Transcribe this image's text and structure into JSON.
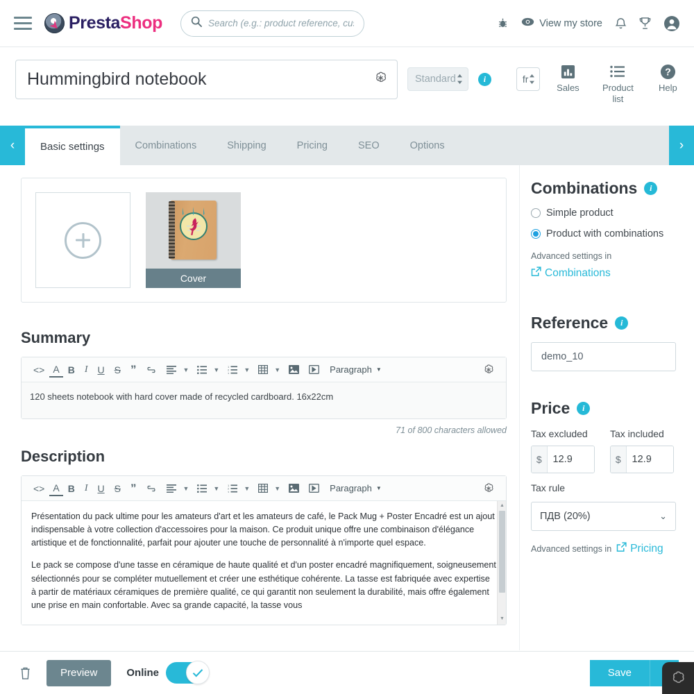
{
  "topnav": {
    "menu_icon": "hamburger-icon",
    "brand": {
      "pre": "Presta",
      "post": "Shop"
    },
    "search": {
      "placeholder": "Search (e.g.: product reference, custon",
      "value": "",
      "icon": "search-icon"
    },
    "bug_icon": "bug-icon",
    "view_store": {
      "label": "View my store",
      "icon": "eye-icon"
    },
    "bell_icon": "bell-icon",
    "trophy_icon": "trophy-icon",
    "account_icon": "user-avatar-icon"
  },
  "product_header": {
    "name_value": "Hummingbird notebook",
    "name_ai_icon": "ai-assistant-icon",
    "type_select": "Standard",
    "type_info_icon": "info-icon",
    "language_select": "fr",
    "actions": [
      {
        "label": "Sales",
        "icon": "bar-chart-icon"
      },
      {
        "label": "Product list",
        "icon": "list-icon"
      },
      {
        "label": "Help",
        "icon": "question-mark-icon"
      }
    ]
  },
  "tabs": {
    "prev_label": "‹",
    "next_label": "›",
    "items": [
      {
        "label": "Basic settings",
        "active": true
      },
      {
        "label": "Combinations",
        "active": false
      },
      {
        "label": "Shipping",
        "active": false
      },
      {
        "label": "Pricing",
        "active": false
      },
      {
        "label": "SEO",
        "active": false
      },
      {
        "label": "Options",
        "active": false
      }
    ]
  },
  "images": {
    "add_tile_icon": "plus-circle-icon",
    "cover_label": "Cover"
  },
  "summary": {
    "title": "Summary",
    "toolbar": {
      "source": "<>",
      "text_color": "A",
      "bold": "B",
      "italic": "I",
      "underline": "U",
      "strikethrough": "S",
      "quote": "”",
      "link": "link-icon",
      "align": "align-left-icon",
      "bullet_list": "bullet-list-icon",
      "number_list": "numbered-list-icon",
      "table": "table-icon",
      "image": "image-icon",
      "video": "video-icon",
      "paragraph": "Paragraph",
      "ai": "ai-assistant-icon"
    },
    "content": "120 sheets notebook with hard cover made of recycled cardboard. 16x22cm",
    "char_count": "71 of 800 characters allowed"
  },
  "description": {
    "title": "Description",
    "paragraphs": [
      "Présentation du pack ultime pour les amateurs d'art et les amateurs de café, le Pack Mug + Poster Encadré est un ajout indispensable à votre collection d'accessoires pour la maison. Ce produit unique offre une combinaison d'élégance artistique et de fonctionnalité, parfait pour ajouter une touche de personnalité à n'importe quel espace.",
      "Le pack se compose d'une tasse en céramique de haute qualité et d'un poster encadré magnifiquement, soigneusement sélectionnés pour se compléter mutuellement et créer une esthétique cohérente. La tasse est fabriquée avec expertise à partir de matériaux céramiques de première qualité, ce qui garantit non seulement la durabilité, mais offre également une prise en main confortable. Avec sa grande capacité, la tasse vous"
    ]
  },
  "combinations": {
    "title": "Combinations",
    "info_icon": "info-icon",
    "option_simple": "Simple product",
    "option_with_combinations": "Product with combinations",
    "selected": "Product with combinations",
    "advanced_note": "Advanced settings in",
    "link_label": "Combinations",
    "link_icon": "external-link-icon"
  },
  "reference": {
    "title": "Reference",
    "info_icon": "info-icon",
    "value": "demo_10"
  },
  "price": {
    "title": "Price",
    "info_icon": "info-icon",
    "tax_excluded_label": "Tax excluded",
    "tax_included_label": "Tax included",
    "currency_symbol": "$",
    "tax_excluded_value": "12.9",
    "tax_included_value": "12.9",
    "tax_rule_label": "Tax rule",
    "tax_rule_value": "ПДВ (20%)",
    "advanced_note": "Advanced settings in",
    "link_label": "Pricing",
    "link_icon": "external-link-icon"
  },
  "footer": {
    "delete_icon": "trash-icon",
    "preview_label": "Preview",
    "online_label": "Online",
    "online_state": true,
    "save_label": "Save",
    "save_caret_icon": "chevron-down-icon",
    "widget_icon": "chat-widget-icon"
  },
  "colors": {
    "accent": "#28b9d8",
    "brand_dark": "#2a1f62",
    "brand_pink": "#ec2e7f",
    "preview_gray": "#6c868f"
  }
}
